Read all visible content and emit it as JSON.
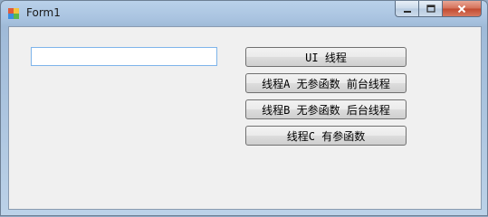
{
  "window": {
    "title": "Form1",
    "icon": "winforms-app-icon",
    "caption": {
      "minimize_icon": "minimize-icon",
      "maximize_icon": "maximize-icon",
      "close_icon": "close-icon"
    }
  },
  "form": {
    "textbox": {
      "value": "",
      "placeholder": ""
    },
    "buttons": [
      {
        "label": "UI 线程"
      },
      {
        "label": "线程A 无参函数 前台线程"
      },
      {
        "label": "线程B 无参函数 后台线程"
      },
      {
        "label": "线程C 有参函数"
      }
    ]
  }
}
